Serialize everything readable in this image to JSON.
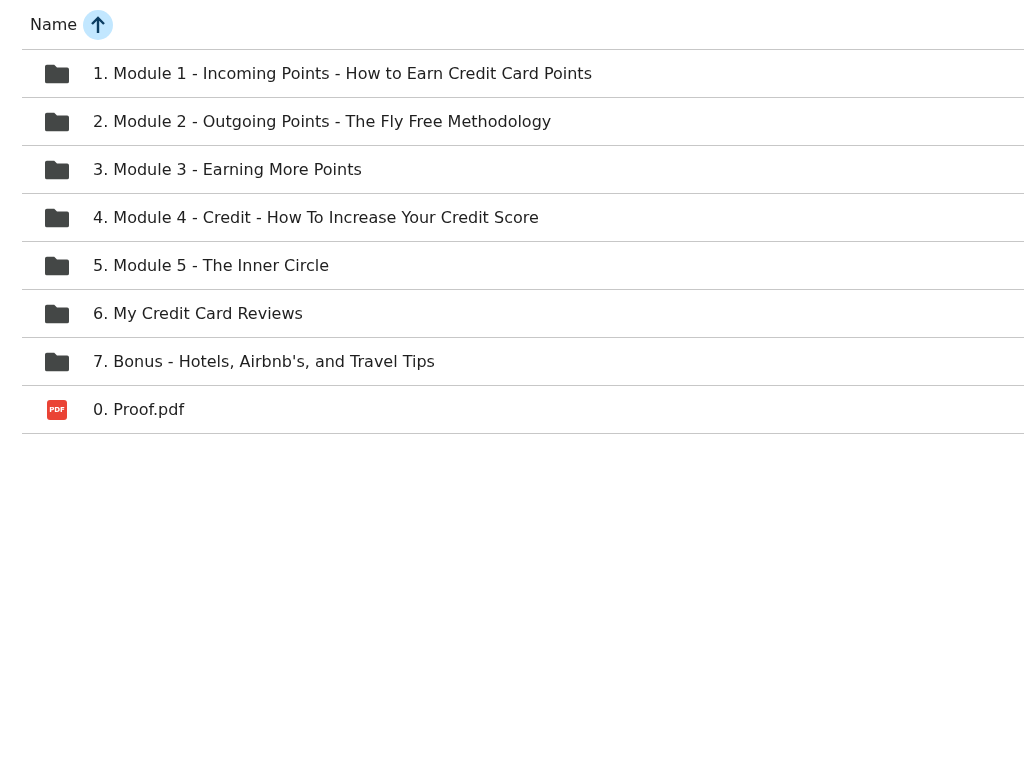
{
  "header": {
    "label": "Name"
  },
  "files": [
    {
      "kind": "folder",
      "name": "1. Module 1 - Incoming Points - How to Earn Credit Card Points"
    },
    {
      "kind": "folder",
      "name": "2. Module 2 - Outgoing Points - The Fly Free Methodology"
    },
    {
      "kind": "folder",
      "name": "3. Module 3 - Earning More Points"
    },
    {
      "kind": "folder",
      "name": "4. Module 4 - Credit - How To Increase Your Credit Score"
    },
    {
      "kind": "folder",
      "name": "5. Module 5 - The Inner Circle"
    },
    {
      "kind": "folder",
      "name": "6. My Credit Card Reviews"
    },
    {
      "kind": "folder",
      "name": "7. Bonus - Hotels, Airbnb's, and Travel Tips"
    },
    {
      "kind": "pdf",
      "badge": "PDF",
      "name": "0. Proof.pdf"
    }
  ]
}
